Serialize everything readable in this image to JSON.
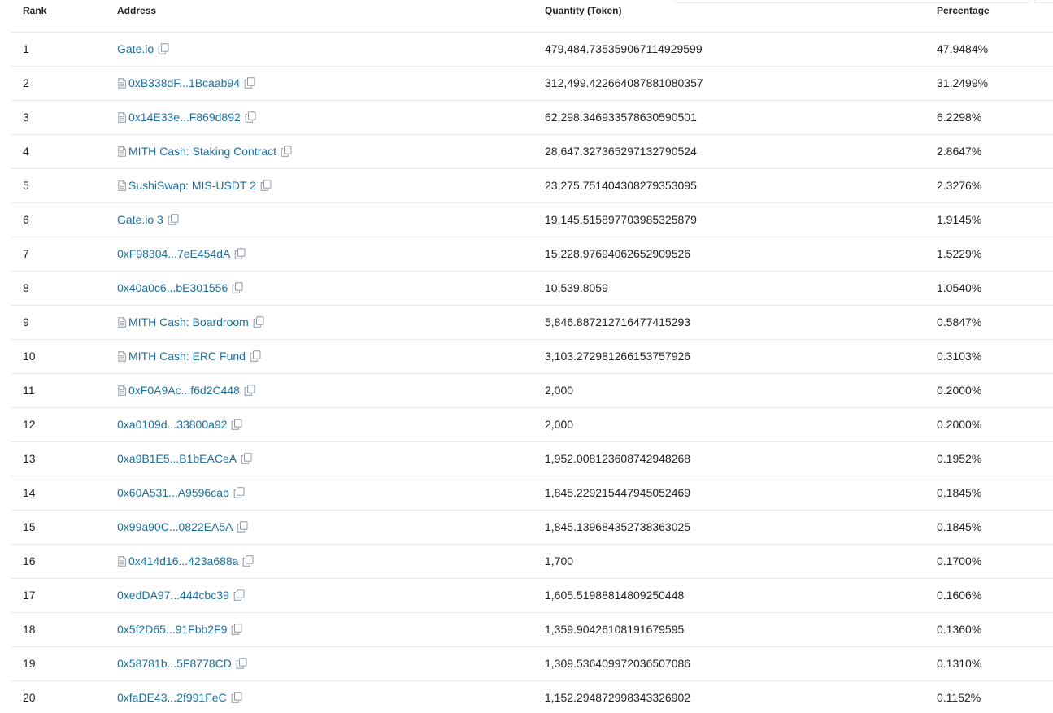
{
  "table": {
    "headers": {
      "rank": "Rank",
      "address": "Address",
      "quantity": "Quantity (Token)",
      "percentage": "Percentage"
    },
    "rows": [
      {
        "rank": "1",
        "address": "Gate.io",
        "contract": false,
        "quantity": "479,484.735359067114929599",
        "percentage": "47.9484%"
      },
      {
        "rank": "2",
        "address": "0xB338dF...1Bcaab94",
        "contract": true,
        "quantity": "312,499.422664087881080357",
        "percentage": "31.2499%"
      },
      {
        "rank": "3",
        "address": "0x14E33e...F869d892",
        "contract": true,
        "quantity": "62,298.346933578630590501",
        "percentage": "6.2298%"
      },
      {
        "rank": "4",
        "address": "MITH Cash: Staking Contract",
        "contract": true,
        "quantity": "28,647.327365297132790524",
        "percentage": "2.8647%"
      },
      {
        "rank": "5",
        "address": "SushiSwap: MIS-USDT 2",
        "contract": true,
        "quantity": "23,275.751404308279353095",
        "percentage": "2.3276%"
      },
      {
        "rank": "6",
        "address": "Gate.io 3",
        "contract": false,
        "quantity": "19,145.515897703985325879",
        "percentage": "1.9145%"
      },
      {
        "rank": "7",
        "address": "0xF98304...7eE454dA",
        "contract": false,
        "quantity": "15,228.97694062652909526",
        "percentage": "1.5229%"
      },
      {
        "rank": "8",
        "address": "0x40a0c6...bE301556",
        "contract": false,
        "quantity": "10,539.8059",
        "percentage": "1.0540%"
      },
      {
        "rank": "9",
        "address": "MITH Cash: Boardroom",
        "contract": true,
        "quantity": "5,846.887212716477415293",
        "percentage": "0.5847%"
      },
      {
        "rank": "10",
        "address": "MITH Cash: ERC Fund",
        "contract": true,
        "quantity": "3,103.272981266153757926",
        "percentage": "0.3103%"
      },
      {
        "rank": "11",
        "address": "0xF0A9Ac...f6d2C448",
        "contract": true,
        "quantity": "2,000",
        "percentage": "0.2000%"
      },
      {
        "rank": "12",
        "address": "0xa0109d...33800a92",
        "contract": false,
        "quantity": "2,000",
        "percentage": "0.2000%"
      },
      {
        "rank": "13",
        "address": "0xa9B1E5...B1bEACeA",
        "contract": false,
        "quantity": "1,952.008123608742948268",
        "percentage": "0.1952%"
      },
      {
        "rank": "14",
        "address": "0x60A531...A9596cab",
        "contract": false,
        "quantity": "1,845.229215447945052469",
        "percentage": "0.1845%"
      },
      {
        "rank": "15",
        "address": "0x99a90C...0822EA5A",
        "contract": false,
        "quantity": "1,845.139684352738363025",
        "percentage": "0.1845%"
      },
      {
        "rank": "16",
        "address": "0x414d16...423a688a",
        "contract": true,
        "quantity": "1,700",
        "percentage": "0.1700%"
      },
      {
        "rank": "17",
        "address": "0xedDA97...444cbc39",
        "contract": false,
        "quantity": "1,605.51988814809250448",
        "percentage": "0.1606%"
      },
      {
        "rank": "18",
        "address": "0x5f2D65...91Fbb2F9",
        "contract": false,
        "quantity": "1,359.90426108191679595",
        "percentage": "0.1360%"
      },
      {
        "rank": "19",
        "address": "0x58781b...5F8778CD",
        "contract": false,
        "quantity": "1,309.536409972036507086",
        "percentage": "0.1310%"
      },
      {
        "rank": "20",
        "address": "0xfaDE43...2f991FeC",
        "contract": false,
        "quantity": "1,152.294872998343326902",
        "percentage": "0.1152%"
      }
    ]
  },
  "icons": {
    "contract": "contract-file-icon",
    "copy": "copy-icon"
  },
  "colors": {
    "link": "#1e6e9c",
    "text": "#1e2022",
    "border": "#e7eaf3"
  }
}
